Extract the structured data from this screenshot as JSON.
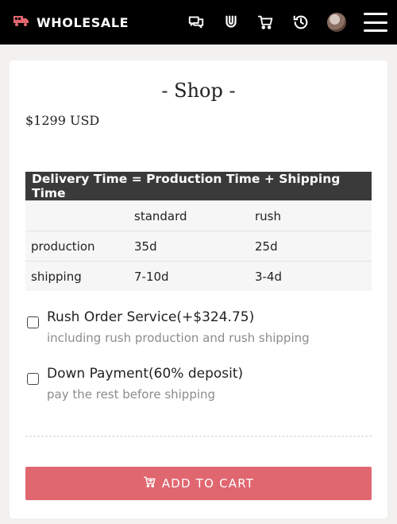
{
  "header": {
    "brand_name": "WHOLESALE",
    "icons": [
      "truck-icon",
      "chat-icon",
      "magnet-icon",
      "cart-icon",
      "history-icon",
      "avatar",
      "menu-icon"
    ]
  },
  "page": {
    "title": "- Shop -",
    "price": "$1299 USD"
  },
  "delivery_table": {
    "heading": "Delivery Time = Production Time + Shipping Time",
    "columns": [
      "",
      "standard",
      "rush"
    ],
    "rows": [
      {
        "label": "production",
        "standard": "35d",
        "rush": "25d"
      },
      {
        "label": "shipping",
        "standard": "7-10d",
        "rush": "3-4d"
      }
    ]
  },
  "options": [
    {
      "label": "Rush Order Service(+$324.75)",
      "sub": "including rush production and rush shipping",
      "checked": false
    },
    {
      "label": "Down Payment(60% deposit)",
      "sub": "pay the rest before shipping",
      "checked": false
    }
  ],
  "cart": {
    "button_label": "ADD TO CART"
  },
  "colors": {
    "header_bg": "#000000",
    "brand_icon": "#e06670",
    "table_header_bg": "#3a3a3a",
    "button_bg": "#e06670",
    "page_bg": "#f3f1ef"
  }
}
